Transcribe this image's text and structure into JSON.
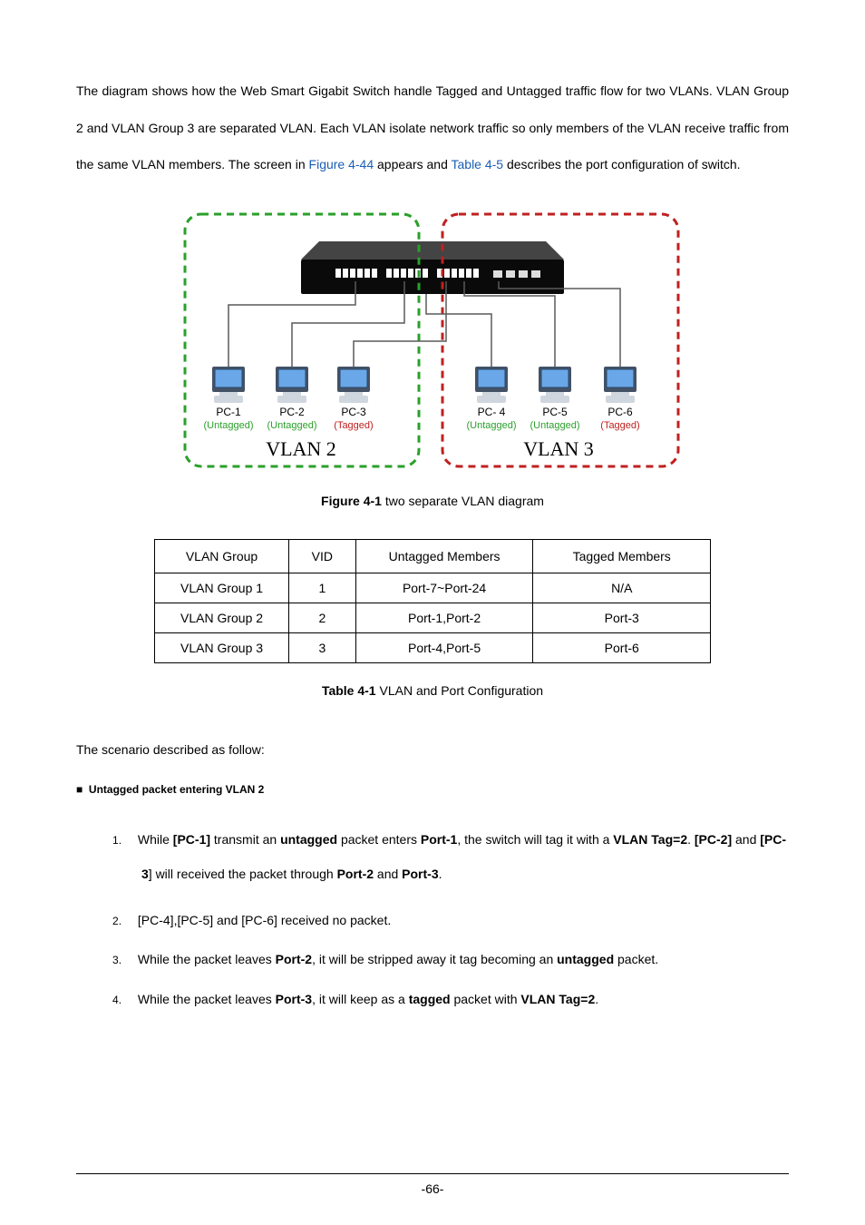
{
  "intro": {
    "p1a": "The diagram shows how the Web Smart Gigabit Switch handle Tagged and Untagged traffic flow for two VLANs. VLAN Group 2 and VLAN Group 3 are separated VLAN. Each VLAN isolate network traffic so only members of the VLAN receive traffic from the same VLAN members. The screen in ",
    "figref": "Figure 4-44",
    "p1b": " appears and ",
    "tblref": "Table 4-5",
    "p1c": " describes the port configuration of switch."
  },
  "figure": {
    "caption_prefix": "Figure 4-1",
    "caption_text": " two separate VLAN diagram",
    "pcs": [
      {
        "name": "PC-1",
        "tag": "(Untagged)",
        "cls": "pc-sub"
      },
      {
        "name": "PC-2",
        "tag": "(Untagged)",
        "cls": "pc-sub"
      },
      {
        "name": "PC-3",
        "tag": "(Tagged)",
        "cls": "pc-sub redt"
      },
      {
        "name": "PC- 4",
        "tag": "(Untagged)",
        "cls": "pc-sub"
      },
      {
        "name": "PC-5",
        "tag": "(Untagged)",
        "cls": "pc-sub"
      },
      {
        "name": "PC-6",
        "tag": "(Tagged)",
        "cls": "pc-sub redt"
      }
    ],
    "vlan2": "VLAN 2",
    "vlan3": "VLAN 3"
  },
  "table": {
    "headers": [
      "VLAN Group",
      "VID",
      "Untagged Members",
      "Tagged Members"
    ],
    "rows": [
      [
        "VLAN Group 1",
        "1",
        "Port-7~Port-24",
        "N/A"
      ],
      [
        "VLAN Group 2",
        "2",
        "Port-1,Port-2",
        "Port-3"
      ],
      [
        "VLAN Group 3",
        "3",
        "Port-4,Port-5",
        "Port-6"
      ]
    ],
    "caption_prefix": "Table 4-1",
    "caption_text": " VLAN and Port Configuration"
  },
  "scenario": {
    "intro": "The scenario described as follow:",
    "bullet_label": "Untagged packet entering VLAN 2",
    "steps": {
      "s1": {
        "t0": "While ",
        "b0": "[PC-1]",
        "t1": " transmit an ",
        "b1": "untagged",
        "t2": " packet enters ",
        "b2": "Port-1",
        "t3": ", the switch will tag it with a ",
        "b3": "VLAN Tag=2",
        "t4": ". ",
        "b4": "[PC-2]",
        "t5": " and ",
        "b5": "[PC-3",
        "t6": "] will received the packet through ",
        "b6": "Port-2",
        "t7": " and ",
        "b7": "Port-3",
        "t8": "."
      },
      "s2": {
        "t0": "[PC-4],[PC-5] and [PC-6] received no packet."
      },
      "s3": {
        "t0": "While the packet leaves ",
        "b0": "Port-2",
        "t1": ", it will be stripped away it tag becoming an ",
        "b1": "untagged",
        "t2": " packet."
      },
      "s4": {
        "t0": "While the packet leaves ",
        "b0": "Port-3",
        "t1": ", it will keep as a ",
        "b1": "tagged",
        "t2": " packet with ",
        "b2": "VLAN Tag=2",
        "t3": "."
      }
    }
  },
  "page_number": "-66-"
}
